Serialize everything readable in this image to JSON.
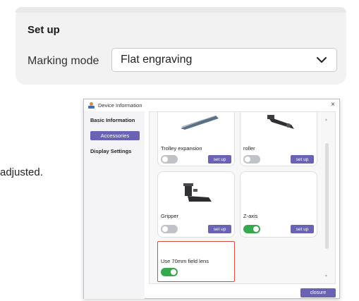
{
  "setup": {
    "title": "Set up",
    "marking_mode_label": "Marking mode",
    "marking_mode_value": "Flat engraving"
  },
  "background_text": "adjusted.",
  "dialog": {
    "title": "Device Information",
    "close_glyph": "×",
    "sidebar": {
      "items": [
        {
          "label": "Basic Information",
          "active": false
        },
        {
          "label": "Accessories",
          "active": true
        },
        {
          "label": "Display Settings",
          "active": false
        }
      ]
    },
    "accessories": [
      {
        "name": "Trolley expansion",
        "enabled": false,
        "button": "set up",
        "icon": "trolley-icon"
      },
      {
        "name": "roller",
        "enabled": false,
        "button": "set up",
        "icon": "roller-icon"
      },
      {
        "name": "Gripper",
        "enabled": false,
        "button": "set up",
        "icon": "gripper-icon"
      },
      {
        "name": "Z-axis",
        "enabled": true,
        "button": "set up",
        "icon": "z-axis-icon"
      },
      {
        "name": "Use 70mm field lens",
        "enabled": true
      }
    ],
    "closure_label": "closure"
  },
  "colors": {
    "accent": "#6a63b3",
    "toggle_on": "#36a84d",
    "toggle_off": "#bfc2c7",
    "highlight": "#d94a3f"
  }
}
